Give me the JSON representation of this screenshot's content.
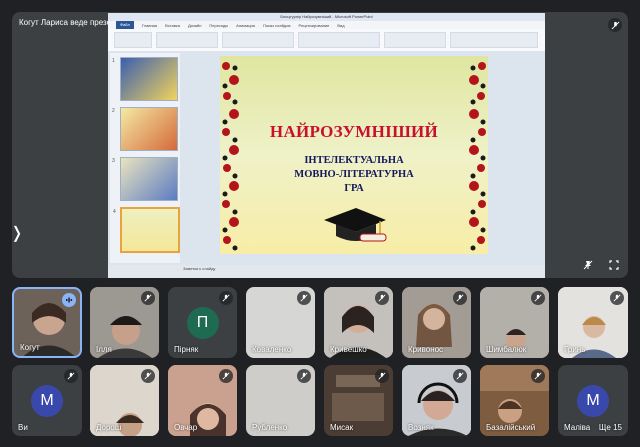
{
  "presenter": {
    "label": "Когут Лариса веде презентацію"
  },
  "presentation": {
    "window_title": "Блицтурнір Найрозумніший - Microsoft PowerPoint",
    "ribbon_tabs": [
      "Файл",
      "Главная",
      "Вставка",
      "Дизайн",
      "Переходы",
      "Анимация",
      "Показ слайдов",
      "Рецензирование",
      "Вид"
    ],
    "notes_placeholder": "Заметки к слайду",
    "slide": {
      "title": "НАЙРОЗУМНІШИЙ",
      "subtitle": [
        "ІНТЕЛЕКТУАЛЬНА",
        "МОВНО-ЛІТЕРАТУРНА",
        "ГРА"
      ]
    },
    "thumbnail_numbers": [
      "1",
      "2",
      "3",
      "4"
    ]
  },
  "participants": [
    {
      "name": "Когут",
      "type": "video",
      "speaking": true
    },
    {
      "name": "Ілля",
      "type": "video"
    },
    {
      "name": "Пірняк",
      "type": "avatar",
      "initial": "П",
      "color": "#1e6b52"
    },
    {
      "name": "Коваленко",
      "type": "video"
    },
    {
      "name": "Кривешко",
      "type": "video"
    },
    {
      "name": "Кривонос",
      "type": "video"
    },
    {
      "name": "Шимбалюк",
      "type": "video"
    },
    {
      "name": "Гринь",
      "type": "video"
    },
    {
      "name": "Ви",
      "type": "avatar",
      "initial": "M",
      "color": "#3949ab"
    },
    {
      "name": "Дорош",
      "type": "video"
    },
    {
      "name": "Овчар",
      "type": "video"
    },
    {
      "name": "Рубленко",
      "type": "video"
    },
    {
      "name": "Мисак",
      "type": "video"
    },
    {
      "name": "Возняк",
      "type": "video"
    },
    {
      "name": "Базалійський",
      "type": "video"
    },
    {
      "name": "Маліва",
      "type": "avatar",
      "initial": "M",
      "color": "#3949ab"
    }
  ],
  "more_participants": "Ще 15",
  "colors": {
    "background": "#202124",
    "tile": "#3c4043",
    "speaking": "#8ab4f8"
  }
}
